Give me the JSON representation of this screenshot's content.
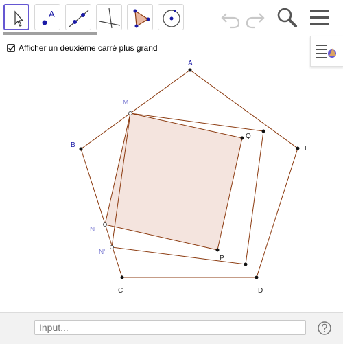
{
  "toolbar": {
    "tools": [
      {
        "name": "move-tool",
        "icon": "pointer-arrow-icon",
        "active": true
      },
      {
        "name": "point-tool",
        "icon": "point-icon",
        "active": false,
        "glyph": "A"
      },
      {
        "name": "line-tool",
        "icon": "line-through-points-icon",
        "active": false
      },
      {
        "name": "perpendicular-line-tool",
        "icon": "perpendicular-line-icon",
        "active": false
      },
      {
        "name": "polygon-tool",
        "icon": "polygon-icon",
        "active": false
      },
      {
        "name": "circle-tool",
        "icon": "circle-with-center-icon",
        "active": false
      }
    ],
    "actions": [
      {
        "name": "undo",
        "icon": "undo-icon"
      },
      {
        "name": "redo",
        "icon": "redo-icon"
      },
      {
        "name": "search",
        "icon": "search-icon"
      },
      {
        "name": "menu",
        "icon": "hamburger-menu-icon"
      }
    ]
  },
  "style_bar": {
    "icon": "style-bar-toggle-icon"
  },
  "checkbox": {
    "label": "Afficher un deuxième carré plus grand",
    "checked": true
  },
  "points": {
    "A": "A",
    "B": "B",
    "C": "C",
    "D": "D",
    "E": "E",
    "M": "M",
    "N": "N",
    "P": "P",
    "Q": "Q",
    "N2": "N'"
  },
  "colors": {
    "segment": "#8b3a0f",
    "square_fill": "#f4e4de",
    "blue_label": "#1a1aa6",
    "light_label": "#7f7fd4",
    "active_tool": "#6557d2"
  },
  "input_bar": {
    "placeholder": "Input...",
    "help_icon": "help-icon"
  }
}
